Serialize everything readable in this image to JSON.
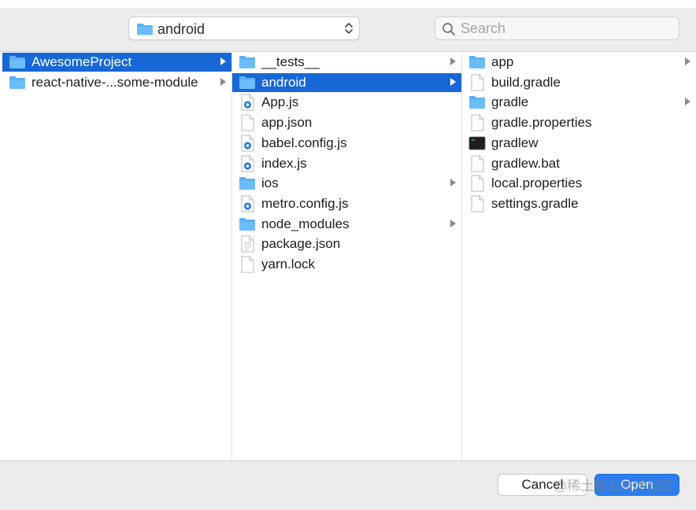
{
  "toolbar": {
    "path_label": "android",
    "search_placeholder": "Search"
  },
  "colors": {
    "selection": "#1767d7",
    "folder": "#5aaff5",
    "open_button": "#2c7ef0",
    "toolbar_bg": "#ececec"
  },
  "columns": [
    {
      "items": [
        {
          "name": "AwesomeProject",
          "icon": "folder-icon",
          "folder": true,
          "selected": true
        },
        {
          "name": "react-native-...some-module",
          "icon": "folder-icon",
          "folder": true,
          "selected": false
        }
      ]
    },
    {
      "items": [
        {
          "name": "__tests__",
          "icon": "folder-icon",
          "folder": true,
          "selected": false
        },
        {
          "name": "android",
          "icon": "folder-icon",
          "folder": true,
          "selected": true
        },
        {
          "name": "App.js",
          "icon": "js-file-icon",
          "folder": false,
          "selected": false
        },
        {
          "name": "app.json",
          "icon": "document-icon",
          "folder": false,
          "selected": false
        },
        {
          "name": "babel.config.js",
          "icon": "js-file-icon",
          "folder": false,
          "selected": false
        },
        {
          "name": "index.js",
          "icon": "js-file-icon",
          "folder": false,
          "selected": false
        },
        {
          "name": "ios",
          "icon": "folder-icon",
          "folder": true,
          "selected": false
        },
        {
          "name": "metro.config.js",
          "icon": "js-file-icon",
          "folder": false,
          "selected": false
        },
        {
          "name": "node_modules",
          "icon": "folder-icon",
          "folder": true,
          "selected": false
        },
        {
          "name": "package.json",
          "icon": "text-file-icon",
          "folder": false,
          "selected": false
        },
        {
          "name": "yarn.lock",
          "icon": "document-icon",
          "folder": false,
          "selected": false
        }
      ]
    },
    {
      "items": [
        {
          "name": "app",
          "icon": "folder-icon",
          "folder": true,
          "selected": false
        },
        {
          "name": "build.gradle",
          "icon": "document-icon",
          "folder": false,
          "selected": false
        },
        {
          "name": "gradle",
          "icon": "folder-icon",
          "folder": true,
          "selected": false
        },
        {
          "name": "gradle.properties",
          "icon": "document-icon",
          "folder": false,
          "selected": false
        },
        {
          "name": "gradlew",
          "icon": "terminal-icon",
          "folder": false,
          "selected": false
        },
        {
          "name": "gradlew.bat",
          "icon": "document-icon",
          "folder": false,
          "selected": false
        },
        {
          "name": "local.properties",
          "icon": "document-icon",
          "folder": false,
          "selected": false
        },
        {
          "name": "settings.gradle",
          "icon": "document-icon",
          "folder": false,
          "selected": false
        }
      ]
    }
  ],
  "footer": {
    "cancel_label": "Cancel",
    "open_label": "Open",
    "watermark": "@稀土掘金技术社区"
  }
}
